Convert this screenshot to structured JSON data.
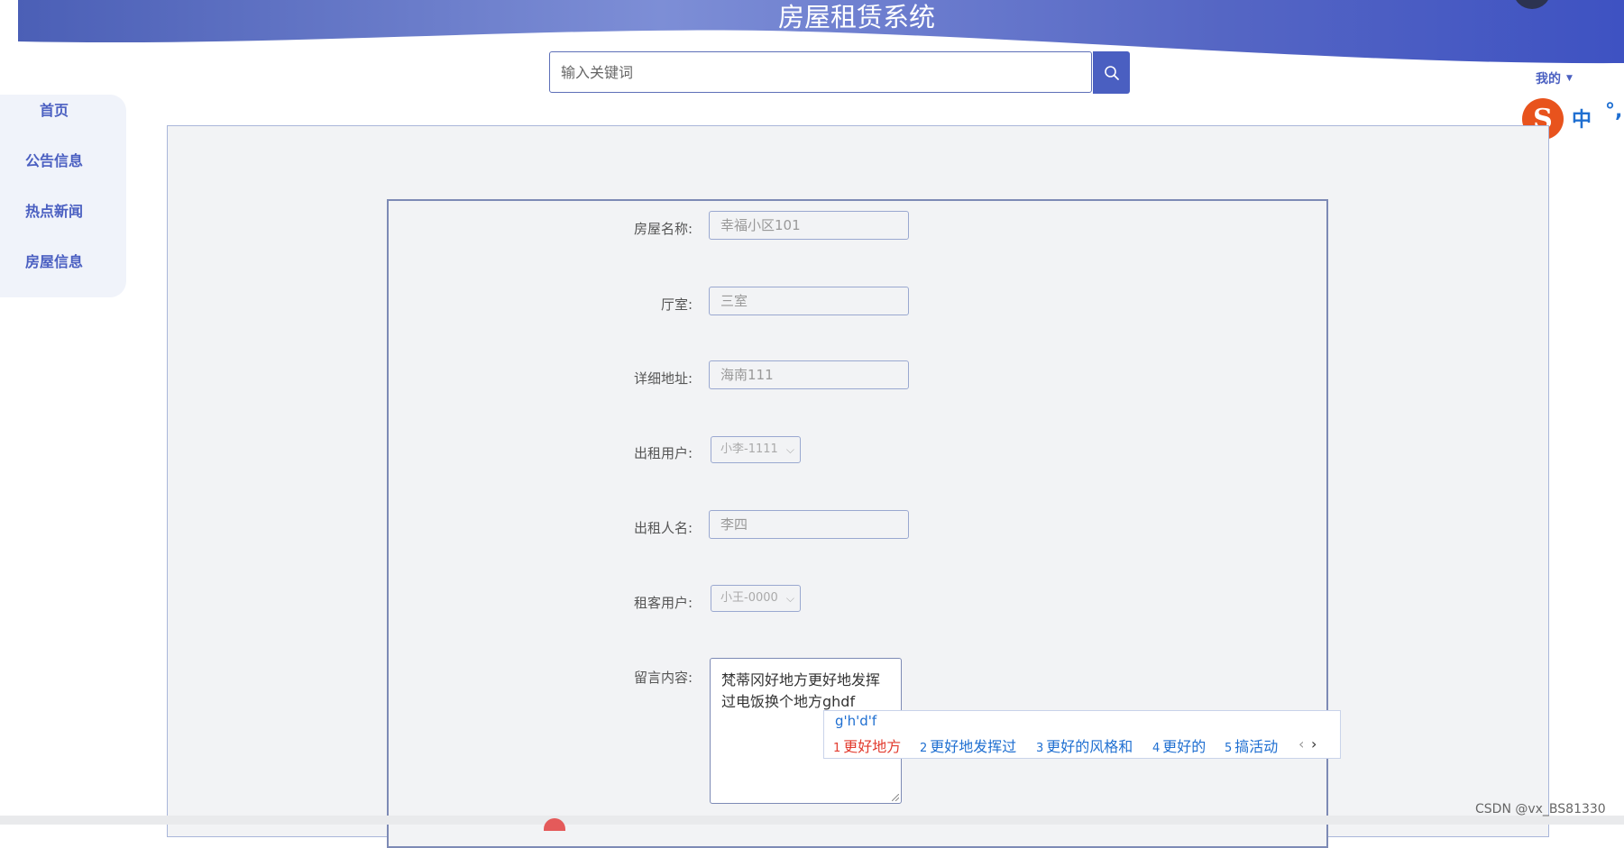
{
  "header": {
    "site_title": "房屋租赁系统",
    "search": {
      "placeholder": "输入关键词"
    },
    "user_menu_label": "我的"
  },
  "ime_toolbar": {
    "logo": "S",
    "mode": "中",
    "punct": "°,"
  },
  "sidebar": {
    "items": [
      {
        "label": "首页"
      },
      {
        "label": "公告信息"
      },
      {
        "label": "热点新闻"
      },
      {
        "label": "房屋信息"
      }
    ]
  },
  "form": {
    "fields": [
      {
        "label": "房屋名称:",
        "value": "幸福小区101"
      },
      {
        "label": "厅室:",
        "value": "三室"
      },
      {
        "label": "详细地址:",
        "value": "海南111"
      },
      {
        "label": "出租用户:",
        "value": "小李-1111"
      },
      {
        "label": "出租人名:",
        "value": "李四"
      },
      {
        "label": "租客用户:",
        "value": "小王-0000"
      },
      {
        "label": "留言内容:",
        "value": "梵蒂冈好地方更好地发挥过电饭换个地方ghdf"
      }
    ]
  },
  "ime_popup": {
    "pinyin": "g'h'd'f",
    "candidates": [
      {
        "num": "1",
        "text": "更好地方"
      },
      {
        "num": "2",
        "text": "更好地发挥过"
      },
      {
        "num": "3",
        "text": "更好的风格和"
      },
      {
        "num": "4",
        "text": "更好的"
      },
      {
        "num": "5",
        "text": "搞活动"
      }
    ],
    "prev": "‹",
    "next": "›"
  },
  "watermark": "CSDN @vx_BS81330",
  "colors": {
    "accent": "#4a5fc1",
    "ime_orange": "#e8531d",
    "ime_blue": "#1f6fd1"
  }
}
